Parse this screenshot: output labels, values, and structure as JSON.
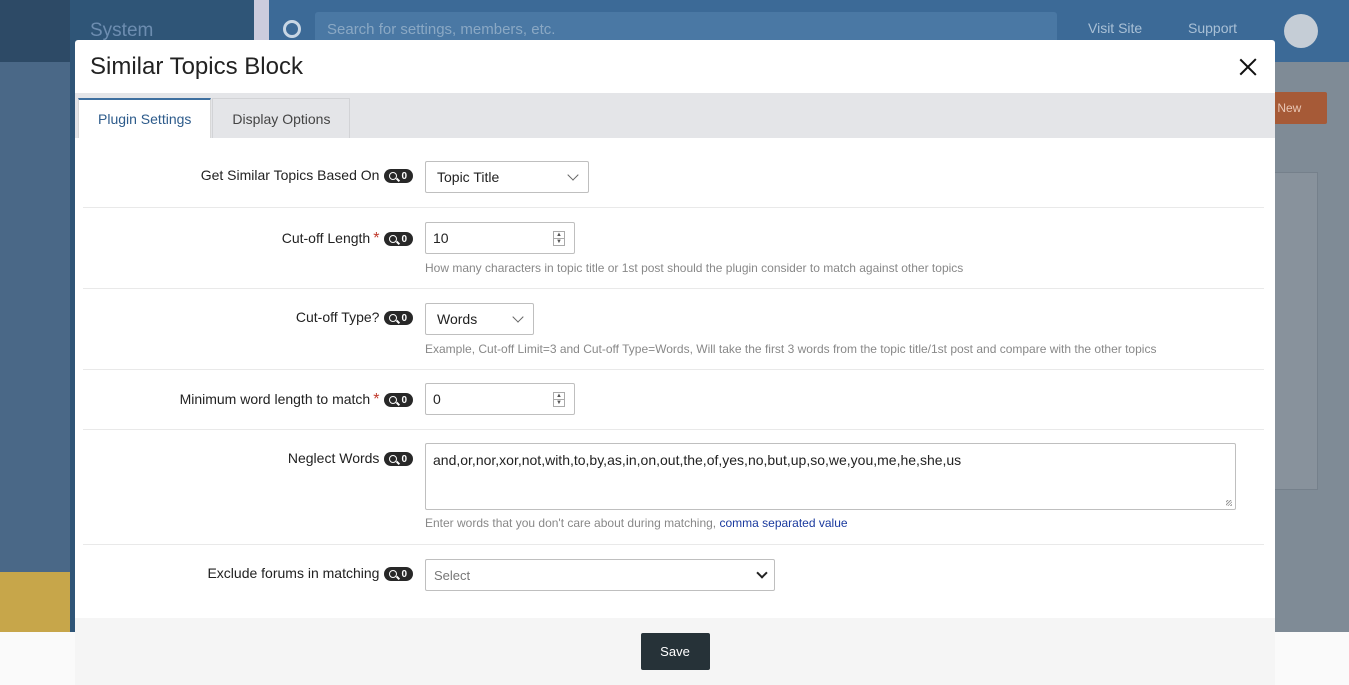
{
  "background": {
    "section_title": "System",
    "search_placeholder": "Search for settings, members, etc.",
    "visit_site": "Visit Site",
    "support": "Support",
    "create_new": "te New"
  },
  "modal": {
    "title": "Similar Topics Block",
    "tabs": [
      {
        "label": "Plugin Settings",
        "active": true
      },
      {
        "label": "Display Options",
        "active": false
      }
    ],
    "fields": {
      "based_on": {
        "label": "Get Similar Topics Based On",
        "badge": "0",
        "value": "Topic Title"
      },
      "cutoff_length": {
        "label": "Cut-off Length",
        "required": "*",
        "badge": "0",
        "value": "10",
        "help": "How many characters in topic title or 1st post should the plugin consider to match against other topics"
      },
      "cutoff_type": {
        "label": "Cut-off Type?",
        "badge": "0",
        "value": "Words",
        "help": "Example, Cut-off Limit=3 and Cut-off Type=Words, Will take the first 3 words from the topic title/1st post and compare with the other topics"
      },
      "min_word_length": {
        "label": "Minimum word length to match",
        "required": "*",
        "badge": "0",
        "value": "0"
      },
      "neglect_words": {
        "label": "Neglect Words",
        "badge": "0",
        "value": "and,or,nor,xor,not,with,to,by,as,in,on,out,the,of,yes,no,but,up,so,we,you,me,he,she,us",
        "help": "Enter words that you don't care about during matching,",
        "help_link": "comma separated value"
      },
      "exclude_forums": {
        "label": "Exclude forums in matching",
        "badge": "0",
        "placeholder": "Select"
      }
    },
    "save_label": "Save"
  },
  "colors": {
    "accent": "#3e6f9f",
    "save_button": "#263238",
    "required": "#c0392b",
    "link": "#1a3a9e"
  }
}
